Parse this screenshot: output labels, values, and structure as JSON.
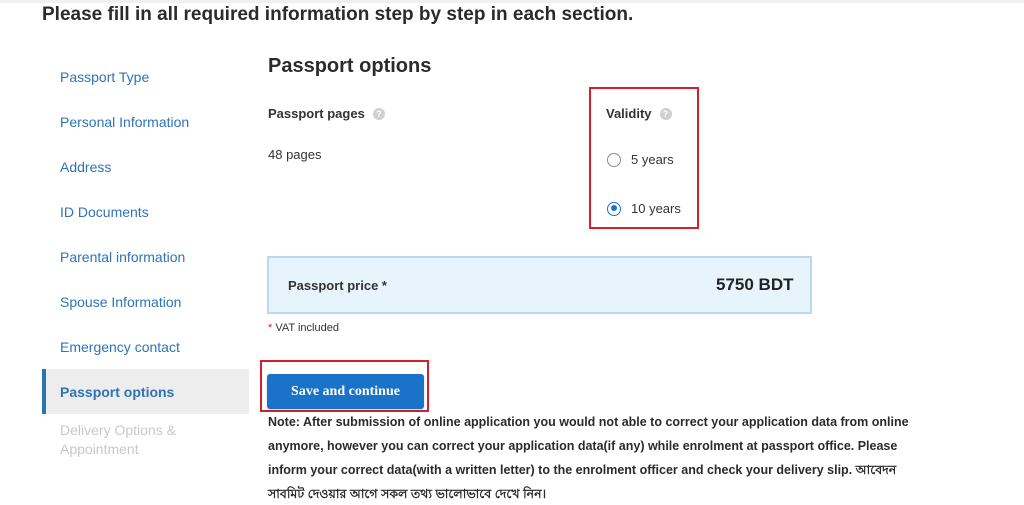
{
  "heading": "Please fill in all required information step by step in each section.",
  "sidebar": {
    "items": [
      {
        "label": "Passport Type"
      },
      {
        "label": "Personal Information"
      },
      {
        "label": "Address"
      },
      {
        "label": "ID Documents"
      },
      {
        "label": "Parental information"
      },
      {
        "label": "Spouse Information"
      },
      {
        "label": "Emergency contact"
      },
      {
        "label": "Passport options"
      },
      {
        "label": "Delivery Options & Appointment"
      }
    ],
    "active_index": 7
  },
  "main": {
    "title": "Passport options",
    "passport_pages": {
      "label": "Passport pages",
      "value": "48 pages",
      "help_icon": "question-icon"
    },
    "validity": {
      "label": "Validity",
      "help_icon": "question-icon",
      "options": [
        {
          "label": "5 years",
          "checked": false
        },
        {
          "label": "10 years",
          "checked": true
        }
      ]
    },
    "price": {
      "label": "Passport price *",
      "value": "5750 BDT"
    },
    "vat_note": {
      "star": "*",
      "text": " VAT included"
    },
    "save_button": "Save and continue",
    "note": "Note: After submission of online application you would not able to correct your application data from online anymore, however you can correct your application data(if any) while enrolment at passport office. Please inform your correct data(with a written letter) to the enrolment officer and check your delivery slip. আবেদন সাবমিট দেওয়ার আগে সকল তথ্য ভালোভাবে দেখে নিন।"
  },
  "colors": {
    "accent": "#1a73c9",
    "link": "#2e74b5",
    "highlight_border": "#d4202c",
    "price_bg": "#e8f4fc"
  }
}
